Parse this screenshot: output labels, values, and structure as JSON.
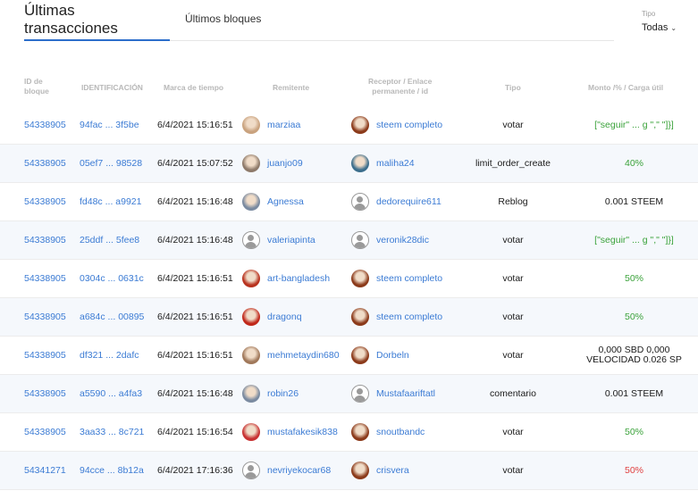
{
  "tabs": {
    "active": "Últimas transacciones",
    "other": "Últimos bloques"
  },
  "filter": {
    "label": "Tipo",
    "value": "Todas"
  },
  "columns": {
    "block": [
      "ID de",
      "bloque"
    ],
    "id": "IDENTIFICACIÓN",
    "time": "Marca de tiempo",
    "sender": "Remitente",
    "receiver": [
      "Receptor / Enlace",
      "permanente / id"
    ],
    "type": "Tipo",
    "amount": "Monto /% / Carga útil"
  },
  "rows": [
    {
      "block": "54338905",
      "id": "94fac ... 3f5be",
      "time": "6/4/2021 15:16:51",
      "sender": "marziaa",
      "sender_avatar": "#c9a27e",
      "receiver": "steem completo",
      "receiver_avatar": "#8b3a1a",
      "type": "votar",
      "amount": "[\"seguir\" ... g \",\" \"]}]",
      "amount_color": "green"
    },
    {
      "block": "54338905",
      "id": "05ef7 ... 98528",
      "time": "6/4/2021 15:07:52",
      "sender": "juanjo09",
      "sender_avatar": "#8e7a6a",
      "receiver": "maliha24",
      "receiver_avatar": "#3c6e8c",
      "type": "limit_order_create",
      "amount": "40%",
      "amount_color": "green"
    },
    {
      "block": "54338905",
      "id": "fd48c ... a9921",
      "time": "6/4/2021 15:16:48",
      "sender": "Agnessa",
      "sender_avatar": "#7a8aa0",
      "receiver": "dedorequire611",
      "receiver_avatar": "person",
      "type": "Reblog",
      "amount": "0.001 STEEM",
      "amount_color": "dark"
    },
    {
      "block": "54338905",
      "id": "25ddf ... 5fee8",
      "time": "6/4/2021 15:16:48",
      "sender": "valeriapinta",
      "sender_avatar": "person",
      "receiver": "veronik28dic",
      "receiver_avatar": "person",
      "type": "votar",
      "amount": "[\"seguir\" ... g \",\" \"]}]",
      "amount_color": "green"
    },
    {
      "block": "54338905",
      "id": "0304c ... 0631c",
      "time": "6/4/2021 15:16:51",
      "sender": "art-bangladesh",
      "sender_avatar": "#b8321e",
      "receiver": "steem completo",
      "receiver_avatar": "#8b3a1a",
      "type": "votar",
      "amount": "50%",
      "amount_color": "green"
    },
    {
      "block": "54338905",
      "id": "a684c ... 00895",
      "time": "6/4/2021 15:16:51",
      "sender": "dragonq",
      "sender_avatar": "#c0281a",
      "receiver": "steem completo",
      "receiver_avatar": "#8b3a1a",
      "type": "votar",
      "amount": "50%",
      "amount_color": "green"
    },
    {
      "block": "54338905",
      "id": "df321 ... 2dafc",
      "time": "6/4/2021 15:16:51",
      "sender": "mehmetaydin680",
      "sender_avatar": "#a0785a",
      "receiver": "Dorbeln",
      "receiver_avatar": "#8b3a1a",
      "type": "votar",
      "amount": "0,000 SBD 0,000\nVELOCIDAD 0.026 SP",
      "amount_color": "dark"
    },
    {
      "block": "54338905",
      "id": "a5590 ... a4fa3",
      "time": "6/4/2021 15:16:48",
      "sender": "robin26",
      "sender_avatar": "#7a8aa0",
      "receiver": "Mustafaariftatl",
      "receiver_avatar": "person",
      "type": "comentario",
      "amount": "0.001 STEEM",
      "amount_color": "dark"
    },
    {
      "block": "54338905",
      "id": "3aa33 ... 8c721",
      "time": "6/4/2021 15:16:54",
      "sender": "mustafakesik838",
      "sender_avatar": "#c83232",
      "receiver": "snoutbandc",
      "receiver_avatar": "#8b3a1a",
      "type": "votar",
      "amount": "50%",
      "amount_color": "green"
    },
    {
      "block": "54341271",
      "id": "94cce ... 8b12a",
      "time": "6/4/2021 17:16:36",
      "sender": "nevriyekocar68",
      "sender_avatar": "person",
      "receiver": "crisvera",
      "receiver_avatar": "#8b3a1a",
      "type": "votar",
      "amount": "50%",
      "amount_color": "red"
    }
  ],
  "colors": {
    "link": "#3b7bd4",
    "green": "#3aa23a",
    "red": "#e04040",
    "accent": "#2c6ecb"
  }
}
